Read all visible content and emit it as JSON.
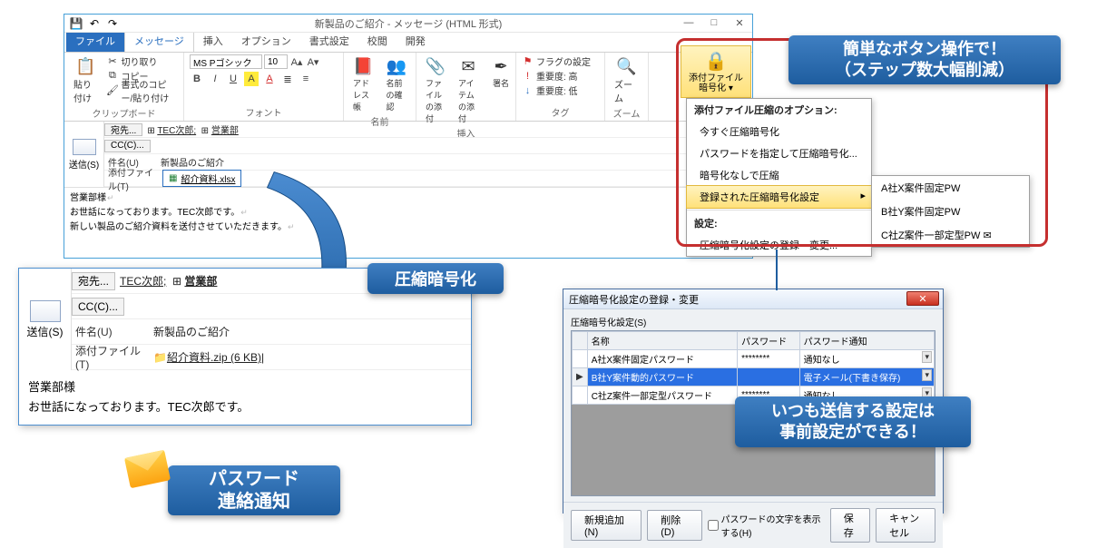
{
  "window": {
    "title": "新製品のご紹介 - メッセージ (HTML 形式)",
    "qat_undo": "↶",
    "qat_redo": "↷"
  },
  "tabs": {
    "file": "ファイル",
    "message": "メッセージ",
    "insert": "挿入",
    "option": "オプション",
    "format": "書式設定",
    "review": "校閲",
    "dev": "開発"
  },
  "ribbon": {
    "clipboard": {
      "paste": "貼り付け",
      "cut": "切り取り",
      "copy": "コピー",
      "fmtcopy": "書式のコピー/貼り付け",
      "label": "クリップボード"
    },
    "font": {
      "name": "MS Pゴシック",
      "size": "10",
      "label": "フォント"
    },
    "names": {
      "address": "アドレス帳",
      "check": "名前の確認",
      "label": "名前"
    },
    "include": {
      "file": "ファイルの添付",
      "item": "アイテムの添付",
      "sign": "署名",
      "label": "挿入"
    },
    "tags": {
      "flag": "フラグの設定",
      "imp_high": "重要度: 高",
      "imp_low": "重要度: 低",
      "label": "タグ"
    },
    "zoom": {
      "zoom": "ズーム",
      "label": "ズーム"
    }
  },
  "compose": {
    "send": "送信(S)",
    "to_btn": "宛先...",
    "to_val": "TEC次郎;",
    "to_val2": "営業部",
    "cc_btn": "CC(C)...",
    "subject_lbl": "件名(U)",
    "subject_val": "新製品のご紹介",
    "attach_lbl": "添付ファイル(T)",
    "attach_name": "紹介資料.xlsx",
    "body_l1": "営業部様",
    "body_l2": "お世話になっております。TEC次郎です。",
    "body_l3": "新しい製品のご紹介資料を送付させていただきます。"
  },
  "zoom_compose": {
    "attach_name": "紹介資料.zip (6 KB)"
  },
  "callouts": {
    "c1": "圧縮暗号化",
    "c2a": "簡単なボタン操作で！",
    "c2b": "（ステップ数大幅削減）",
    "c3a": "パスワード",
    "c3b": "連絡通知",
    "c4a": "いつも送信する設定は",
    "c4b": "事前設定ができる！"
  },
  "addin": {
    "btn_l1": "添付ファイル",
    "btn_l2": "暗号化",
    "menu_hdr1": "添付ファイル圧縮のオプション:",
    "mi1": "今すぐ圧縮暗号化",
    "mi2": "パスワードを指定して圧縮暗号化...",
    "mi3": "暗号化なしで圧縮",
    "mi4": "登録された圧縮暗号化設定",
    "menu_hdr2": "設定:",
    "mi5": "圧縮暗号化設定の登録・変更...",
    "sub1": "A社X案件固定PW",
    "sub2": "B社Y案件固定PW",
    "sub3": "C社Z案件一部定型PW"
  },
  "dialog": {
    "title": "圧縮暗号化設定の登録・変更",
    "list_lbl": "圧縮暗号化設定(S)",
    "col_name": "名称",
    "col_pw": "パスワード",
    "col_notify": "パスワード通知",
    "rows": [
      {
        "name": "A社X案件固定パスワード",
        "pw": "********",
        "notify": "通知なし"
      },
      {
        "name": "B社Y案件動的パスワード",
        "pw": "",
        "notify": "電子メール(下書き保存)"
      },
      {
        "name": "C社Z案件一部定型パスワード",
        "pw": "********",
        "notify": "通知なし"
      }
    ],
    "btn_add": "新規追加(N)",
    "btn_del": "削除(D)",
    "chk_showpw": "パスワードの文字を表示する(H)",
    "btn_save": "保存",
    "btn_cancel": "キャンセル"
  }
}
